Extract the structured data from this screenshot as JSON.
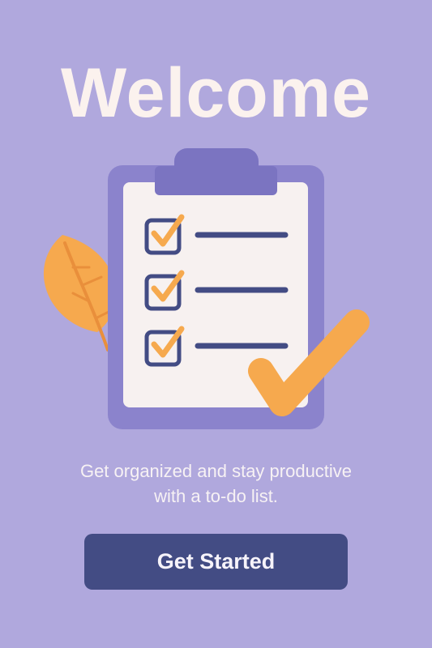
{
  "welcome": {
    "title": "Welcome",
    "subtitle_line1": "Get organized and stay productive",
    "subtitle_line2": "with a to-do list.",
    "cta_label": "Get Started"
  },
  "illustration": {
    "icon": "clipboard-checklist-icon",
    "checklist_items": 3,
    "checked_items": 3
  },
  "colors": {
    "background": "#b0a8dd",
    "title_text": "#fbf2ee",
    "clipboard_board": "#8b83cc",
    "clipboard_clip": "#7b74c1",
    "paper": "#f7f1f0",
    "checkbox_outline": "#434c84",
    "accent_orange": "#f6a94e",
    "button": "#434c84"
  }
}
